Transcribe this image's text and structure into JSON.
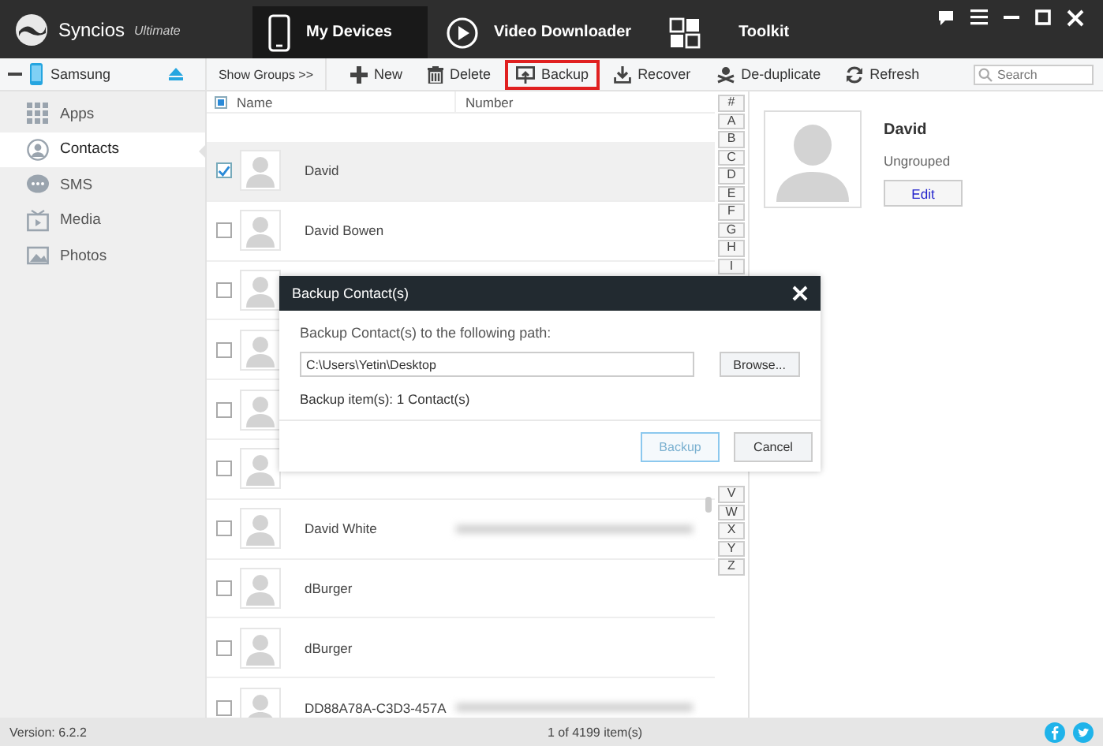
{
  "app": {
    "name": "Syncios",
    "edition": "Ultimate"
  },
  "nav_tabs": [
    {
      "label": "My Devices",
      "selected": true
    },
    {
      "label": "Video Downloader",
      "selected": false
    },
    {
      "label": "Toolkit",
      "selected": false
    }
  ],
  "device": {
    "name": "Samsung"
  },
  "show_groups": "Show Groups  >>",
  "toolbar": [
    {
      "label": "New",
      "highlighted": false
    },
    {
      "label": "Delete",
      "highlighted": false
    },
    {
      "label": "Backup",
      "highlighted": true
    },
    {
      "label": "Recover",
      "highlighted": false
    },
    {
      "label": "De-duplicate",
      "highlighted": false
    },
    {
      "label": "Refresh",
      "highlighted": false
    }
  ],
  "search": {
    "placeholder": "Search"
  },
  "sidebar": {
    "items": [
      {
        "label": "Apps",
        "selected": false
      },
      {
        "label": "Contacts",
        "selected": true
      },
      {
        "label": "SMS",
        "selected": false
      },
      {
        "label": "Media",
        "selected": false
      },
      {
        "label": "Photos",
        "selected": false
      }
    ]
  },
  "table": {
    "select_all_partial": true,
    "columns": [
      "Name",
      "Number"
    ],
    "rows": [
      {
        "name": "David",
        "checked": true,
        "selected": true,
        "number_blurred": false
      },
      {
        "name": "David Bowen",
        "checked": false,
        "selected": false,
        "number_blurred": false
      },
      {
        "checked": false,
        "selected": false,
        "number_blurred": false
      },
      {
        "checked": false,
        "selected": false,
        "number_blurred": false
      },
      {
        "checked": false,
        "selected": false,
        "number_blurred": false
      },
      {
        "checked": false,
        "selected": false,
        "number_blurred": false
      },
      {
        "name": "David White",
        "checked": false,
        "selected": false,
        "number_blurred": true
      },
      {
        "name": "dBurger",
        "checked": false,
        "selected": false,
        "number_blurred": false
      },
      {
        "name": "dBurger",
        "checked": false,
        "selected": false,
        "number_blurred": false
      },
      {
        "name": "DD88A78A-C3D3-457A",
        "checked": false,
        "selected": false,
        "number_blurred": true
      }
    ]
  },
  "index_letters_top": [
    "#",
    "A",
    "B",
    "C",
    "D",
    "E",
    "F",
    "G",
    "H",
    "I"
  ],
  "index_letters_bottom": [
    "V",
    "W",
    "X",
    "Y",
    "Z"
  ],
  "details": {
    "name": "David",
    "group": "Ungrouped",
    "edit": "Edit"
  },
  "dialog": {
    "title": "Backup Contact(s)",
    "prompt": "Backup Contact(s) to the following path:",
    "path": "C:\\Users\\Yetin\\Desktop",
    "browse": "Browse...",
    "info": "Backup item(s): 1 Contact(s)",
    "buttons": [
      {
        "label": "Backup",
        "kind": "primary"
      },
      {
        "label": "Cancel",
        "kind": "normal"
      }
    ]
  },
  "status_bar": {
    "version": "Version: 6.2.2",
    "count": "1 of 4199 item(s)"
  }
}
